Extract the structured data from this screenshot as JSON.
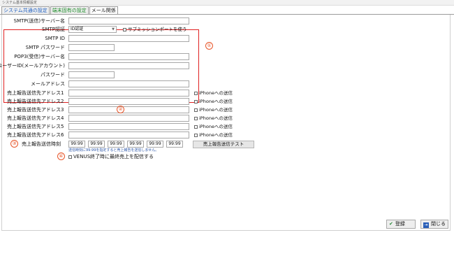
{
  "window": {
    "title": "システム基本情報設定"
  },
  "tabs": [
    {
      "label": "システム共通の設定"
    },
    {
      "label": "端末固有の設定"
    },
    {
      "label": "メール関係"
    }
  ],
  "mail": {
    "smtp_server_label": "SMTP(送信)サーバー名",
    "smtp_auth_label": "SMTP認証",
    "smtp_auth_value": "ID認証",
    "submission_label": "サブミッションポートを使う",
    "smtp_id_label": "SMTP ID",
    "smtp_password_label": "SMTP パスワード",
    "pop3_label": "POP3(受信)サーバー名",
    "userid_label": "ユーザーID(メールアカウント)",
    "password_label": "パスワード",
    "mail_address_label": "メールアドレス"
  },
  "sales": {
    "addresses": [
      {
        "label": "売上報告送信先アドレス1",
        "iphone": "iPhoneへの送信"
      },
      {
        "label": "売上報告送信先アドレス2",
        "iphone": "iPhoneへの送信"
      },
      {
        "label": "売上報告送信先アドレス3",
        "iphone": "iPhoneへの送信"
      },
      {
        "label": "売上報告送信先アドレス4",
        "iphone": "iPhoneへの送信"
      },
      {
        "label": "売上報告送信先アドレス5",
        "iphone": "iPhoneへの送信"
      },
      {
        "label": "売上報告送信先アドレス6",
        "iphone": "iPhoneへの送信"
      }
    ],
    "time_label": "売上報告送信時刻",
    "times": [
      "99:99",
      "99:99",
      "99:99",
      "99:99",
      "99:99",
      "99:99"
    ],
    "test_button": "売上報告送信テスト",
    "note": "送信時刻に99:99を指定すると売上報告を送信しません。",
    "venus_label": "VENUS終了時に最終売上を配信する"
  },
  "markers": [
    "①",
    "②",
    "③",
    "④"
  ],
  "footer": {
    "save": "登録",
    "close": "閉じる"
  },
  "colors": {
    "tab1": "#1f5fbf",
    "tab2": "#1e8a2a",
    "highlight": "#e02020",
    "marker": "#e8562a"
  }
}
